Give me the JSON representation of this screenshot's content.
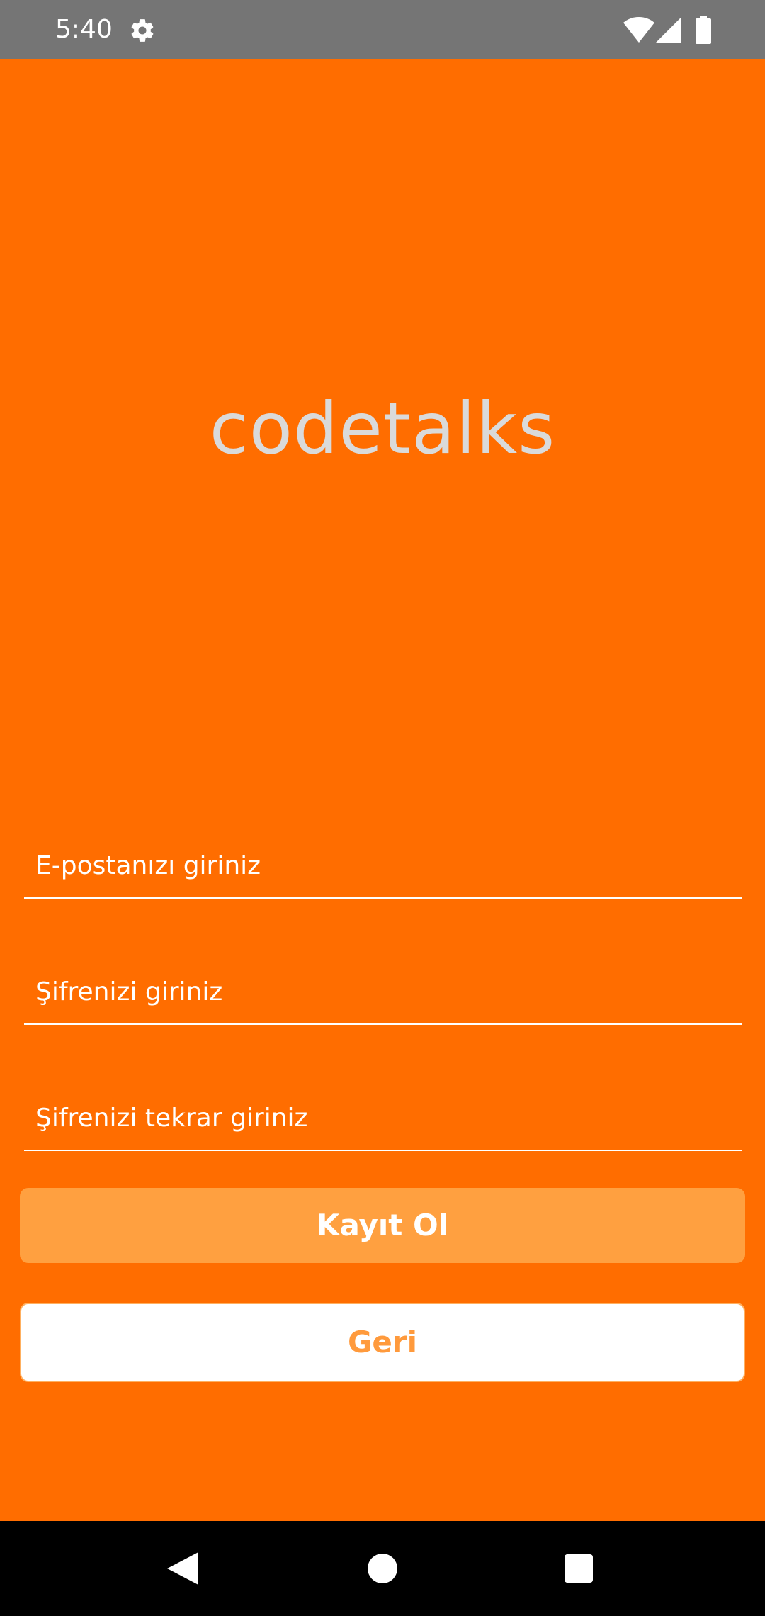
{
  "status_bar": {
    "time": "5:40",
    "icons": [
      "gear-icon",
      "wifi-icon",
      "signal-icon",
      "battery-icon"
    ]
  },
  "app": {
    "title": "codetalks"
  },
  "form": {
    "email_placeholder": "E-postanızı giriniz",
    "password_placeholder": "Şifrenizi giriniz",
    "password_repeat_placeholder": "Şifrenizi tekrar giriniz",
    "register_label": "Kayıt Ol",
    "back_label": "Geri"
  },
  "nav_bar": {
    "icons": [
      "back-icon",
      "home-icon",
      "recents-icon"
    ]
  },
  "colors": {
    "background": "#FF6D00",
    "status_bar": "#757575",
    "register_button": "#FFA040",
    "back_button_text": "#FF9A3C",
    "title_text": "#DADADA"
  }
}
